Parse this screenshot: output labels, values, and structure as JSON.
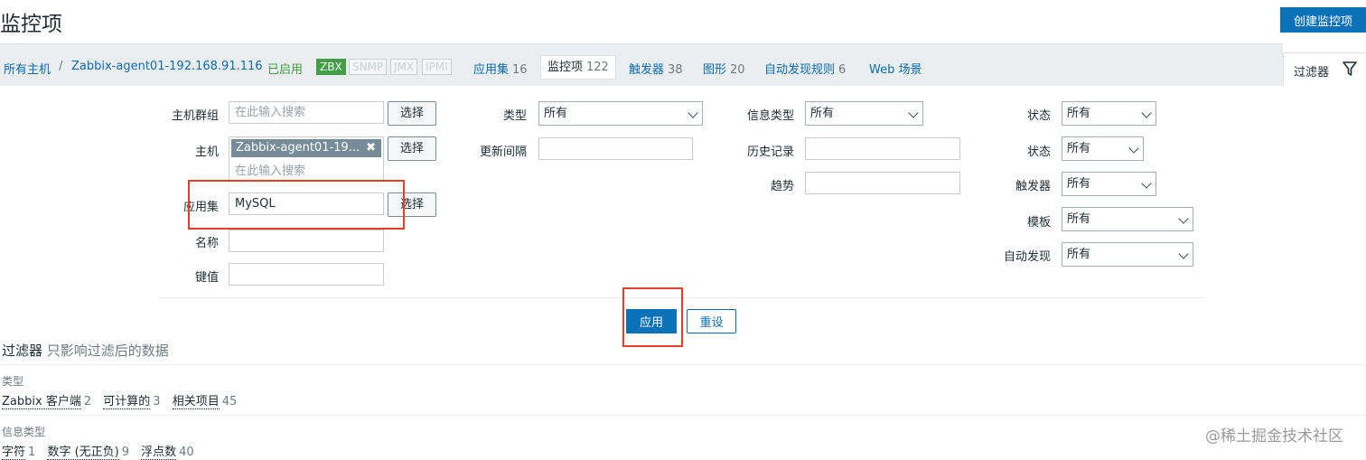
{
  "header": {
    "title": "监控项",
    "create_button": "创建监控项"
  },
  "nav": {
    "all_hosts": "所有主机",
    "separator": "/",
    "host": "Zabbix-agent01-192.168.91.116",
    "status": "已启用",
    "protocols": [
      "ZBX",
      "SNMP",
      "JMX",
      "IPMI"
    ],
    "links": [
      {
        "label": "应用集",
        "count": "16"
      },
      {
        "label": "监控项",
        "count": "122"
      },
      {
        "label": "触发器",
        "count": "38"
      },
      {
        "label": "图形",
        "count": "20"
      },
      {
        "label": "自动发现规则",
        "count": "6"
      },
      {
        "label": "Web 场景",
        "count": ""
      }
    ]
  },
  "filter_tab": {
    "label": "过滤器",
    "icon": "filter-icon"
  },
  "filter": {
    "host_group": {
      "label": "主机群组",
      "placeholder": "在此输入搜索",
      "button": "选择"
    },
    "host": {
      "label": "主机",
      "chip": "Zabbix-agent01-19...",
      "placeholder": "在此输入搜索",
      "button": "选择"
    },
    "application": {
      "label": "应用集",
      "value": "MySQL",
      "button": "选择"
    },
    "name": {
      "label": "名称",
      "value": ""
    },
    "key": {
      "label": "键值",
      "value": ""
    },
    "type": {
      "label": "类型",
      "value": "所有"
    },
    "update_interval": {
      "label": "更新间隔",
      "value": ""
    },
    "info_type": {
      "label": "信息类型",
      "value": "所有"
    },
    "history": {
      "label": "历史记录",
      "value": ""
    },
    "trends": {
      "label": "趋势",
      "value": ""
    },
    "state": {
      "label": "状态",
      "value": "所有"
    },
    "status": {
      "label": "状态",
      "value": "所有"
    },
    "triggers": {
      "label": "触发器",
      "value": "所有"
    },
    "template": {
      "label": "模板",
      "value": "所有"
    },
    "discovery": {
      "label": "自动发现",
      "value": "所有"
    },
    "apply_button": "应用",
    "reset_button": "重设"
  },
  "subfilter": {
    "title": "过滤器",
    "hint": "只影响过滤后的数据",
    "groups": [
      {
        "heading": "类型",
        "options": [
          {
            "label": "Zabbix 客户端",
            "count": "2"
          },
          {
            "label": "可计算的",
            "count": "3"
          },
          {
            "label": "相关项目",
            "count": "45"
          }
        ]
      },
      {
        "heading": "信息类型",
        "options": [
          {
            "label": "字符",
            "count": "1"
          },
          {
            "label": "数字 (无正负)",
            "count": "9"
          },
          {
            "label": "浮点数",
            "count": "40"
          }
        ]
      }
    ]
  },
  "watermark": "@稀土掘金技术社区",
  "colors": {
    "accent": "#0b72b8",
    "enabled": "#429e47",
    "highlight": "#e3402c"
  }
}
